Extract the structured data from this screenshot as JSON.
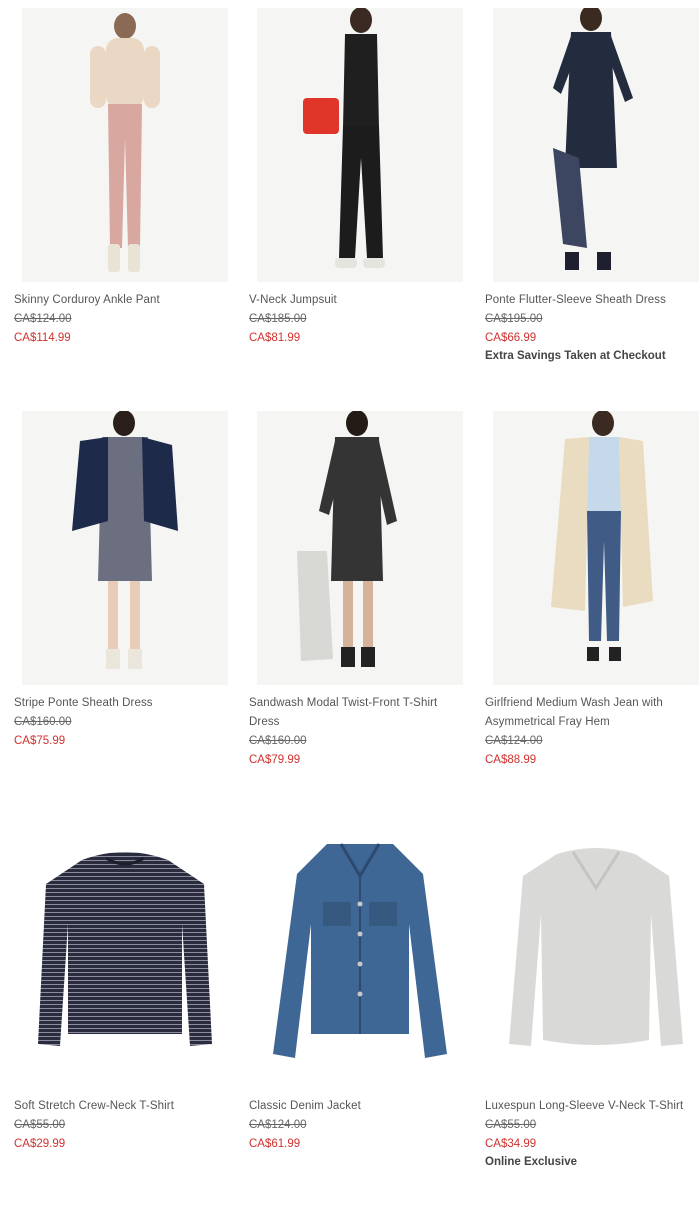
{
  "products": [
    {
      "name": "Skinny Corduroy Ankle Pant",
      "original_price": "CA$124.00",
      "sale_price": "CA$114.99",
      "badge": ""
    },
    {
      "name": "V-Neck Jumpsuit",
      "original_price": "CA$185.00",
      "sale_price": "CA$81.99",
      "badge": ""
    },
    {
      "name": "Ponte Flutter-Sleeve Sheath Dress",
      "original_price": "CA$195.00",
      "sale_price": "CA$66.99",
      "badge": "Extra Savings Taken at Checkout"
    },
    {
      "name": "Stripe Ponte Sheath Dress",
      "original_price": "CA$160.00",
      "sale_price": "CA$75.99",
      "badge": ""
    },
    {
      "name": "Sandwash Modal Twist-Front T-Shirt Dress",
      "original_price": "CA$160.00",
      "sale_price": "CA$79.99",
      "badge": ""
    },
    {
      "name": "Girlfriend Medium Wash Jean with Asymmetrical Fray Hem",
      "original_price": "CA$124.00",
      "sale_price": "CA$88.99",
      "badge": ""
    },
    {
      "name": "Soft Stretch Crew-Neck T-Shirt",
      "original_price": "CA$55.00",
      "sale_price": "CA$29.99",
      "badge": ""
    },
    {
      "name": "Classic Denim Jacket",
      "original_price": "CA$124.00",
      "sale_price": "CA$61.99",
      "badge": ""
    },
    {
      "name": "Luxespun Long-Sleeve V-Neck T-Shirt",
      "original_price": "CA$55.00",
      "sale_price": "CA$34.99",
      "badge": "Online Exclusive"
    }
  ],
  "colors": {
    "sale": "#d0322e",
    "text": "#555555",
    "badge": "#444444"
  }
}
